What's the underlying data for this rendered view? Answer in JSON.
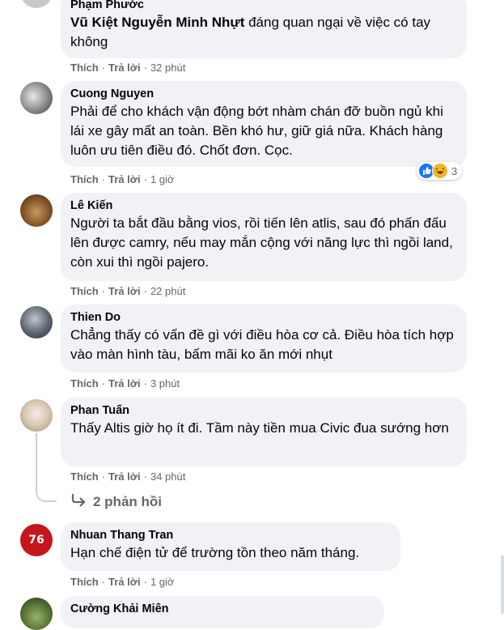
{
  "comments": [
    {
      "author": "Phạm Phước",
      "mention": "Vũ Kiệt Nguyễn Minh Nhựt",
      "text": " đáng quan ngại về việc có tay không",
      "like": "Thích",
      "reply": "Trả lời",
      "time": "32 phút"
    },
    {
      "author": "Cuong Nguyen",
      "text": "Phải để cho khách vận động bớt nhàm chán đỡ buồn ngủ khi lái xe gây mất an toàn. Bền khó hư, giữ giá nữa. Khách hàng luôn ưu tiên điều đó. Chốt đơn. Cọc.",
      "like": "Thích",
      "reply": "Trả lời",
      "time": "1 giờ",
      "reaction_count": "3"
    },
    {
      "author": "Lê Kiến",
      "text": "Người ta bắt đầu bằng vios, rồi tiến lên atlis, sau đó phấn đấu lên được camry, nếu may mắn cộng với năng lực thì ngồi land, còn xui thì ngồi pajero.",
      "like": "Thích",
      "reply": "Trả lời",
      "time": "22 phút"
    },
    {
      "author": "Thien Do",
      "text": "Chẳng thấy có vấn đề gì với điều hòa cơ cả. Điều hòa tích hợp vào màn hình tàu, bấm mãi ko ăn mới nhụt",
      "like": "Thích",
      "reply": "Trả lời",
      "time": "3 phút"
    },
    {
      "author": "Phan Tuấn",
      "text": "Thấy Altis giờ họ ít đi. Tầm này tiền mua Civic đua sướng hơn",
      "like": "Thích",
      "reply": "Trả lời",
      "time": "34 phút",
      "replies": "2 phản hồi"
    },
    {
      "author": "Nhuan Thang Tran",
      "text": "Hạn chế điện tử để trường tồn theo năm tháng.",
      "like": "Thích",
      "reply": "Trả lời",
      "time": "1 giờ",
      "avatar_number": "76"
    },
    {
      "author": "Cường Khải Miên"
    }
  ],
  "icons": {
    "reply_arrow": "reply-arrow-icon",
    "like": "like-reaction-icon",
    "haha": "haha-reaction-icon"
  },
  "colors": {
    "bubble": "#f0f2f5",
    "meta": "#65676b",
    "like_blue": "#1877f2"
  }
}
